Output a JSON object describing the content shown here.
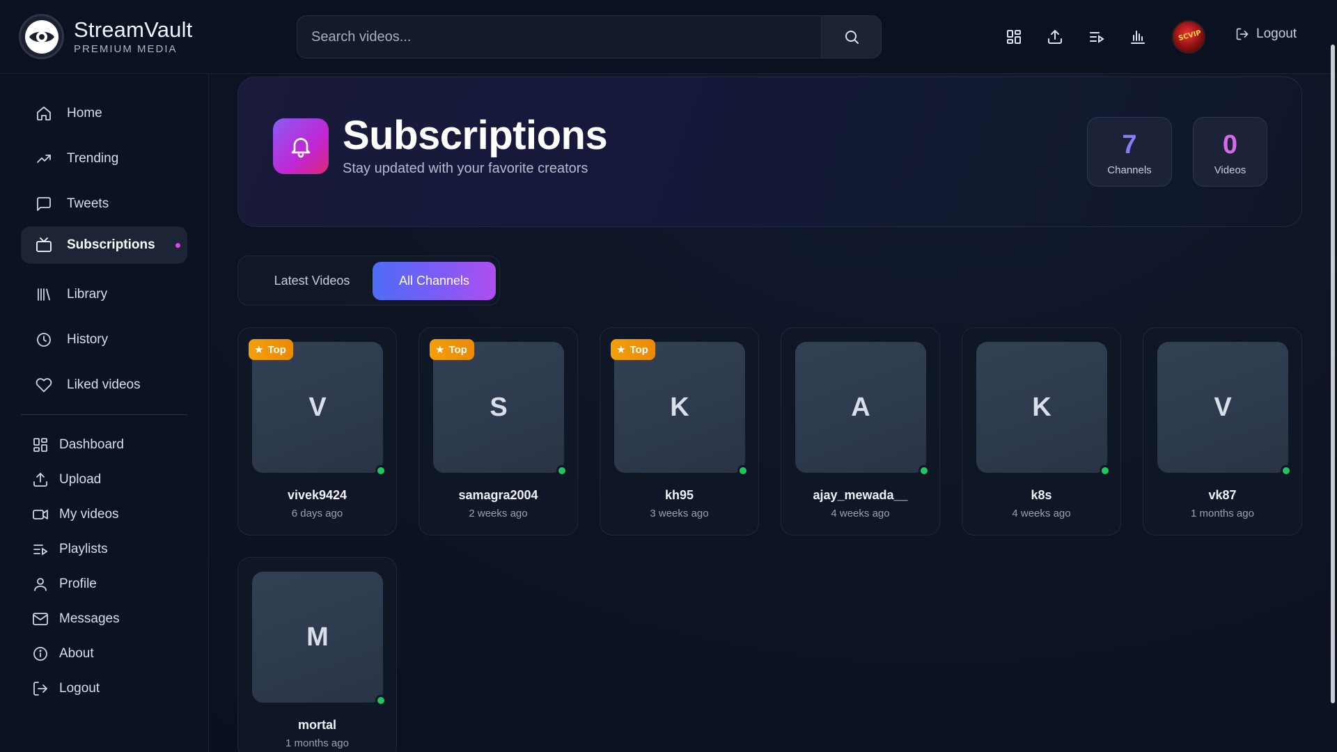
{
  "app": {
    "name": "StreamVault",
    "tagline": "PREMIUM MEDIA"
  },
  "search": {
    "placeholder": "Search videos..."
  },
  "header": {
    "icons": [
      "dashboard-icon",
      "upload-icon",
      "playlist-icon",
      "stats-icon"
    ],
    "logout_label": "Logout"
  },
  "sidebar": {
    "primary": [
      {
        "label": "Home",
        "icon": "home-icon"
      },
      {
        "label": "Trending",
        "icon": "trending-icon"
      },
      {
        "label": "Tweets",
        "icon": "message-square-icon"
      },
      {
        "label": "Subscriptions",
        "icon": "tv-icon",
        "active": true
      },
      {
        "label": "Library",
        "icon": "library-icon"
      },
      {
        "label": "History",
        "icon": "clock-icon"
      },
      {
        "label": "Liked videos",
        "icon": "heart-icon"
      }
    ],
    "secondary": [
      {
        "label": "Dashboard",
        "icon": "dashboard-icon"
      },
      {
        "label": "Upload",
        "icon": "upload-icon"
      },
      {
        "label": "My videos",
        "icon": "video-icon"
      },
      {
        "label": "Playlists",
        "icon": "playlist-icon"
      },
      {
        "label": "Profile",
        "icon": "user-icon"
      },
      {
        "label": "Messages",
        "icon": "mail-icon"
      },
      {
        "label": "About",
        "icon": "info-icon"
      },
      {
        "label": "Logout",
        "icon": "logout-icon"
      }
    ]
  },
  "hero": {
    "title": "Subscriptions",
    "subtitle": "Stay updated with your favorite creators",
    "stats": [
      {
        "value": "7",
        "label": "Channels",
        "color": "#8b7cf6"
      },
      {
        "value": "0",
        "label": "Videos",
        "color": "#d46be8"
      }
    ]
  },
  "tabs": [
    {
      "label": "Latest Videos",
      "active": false
    },
    {
      "label": "All Channels",
      "active": true
    }
  ],
  "channels": [
    {
      "initial": "V",
      "name": "vivek9424",
      "time": "6 days ago",
      "top": true,
      "badge": "Top",
      "online": true
    },
    {
      "initial": "S",
      "name": "samagra2004",
      "time": "2 weeks ago",
      "top": true,
      "badge": "Top",
      "online": true
    },
    {
      "initial": "K",
      "name": "kh95",
      "time": "3 weeks ago",
      "top": true,
      "badge": "Top",
      "online": true
    },
    {
      "initial": "A",
      "name": "ajay_mewada__",
      "time": "4 weeks ago",
      "top": false,
      "online": true
    },
    {
      "initial": "K",
      "name": "k8s",
      "time": "4 weeks ago",
      "top": false,
      "online": true
    },
    {
      "initial": "V",
      "name": "vk87",
      "time": "1 months ago",
      "top": false,
      "online": true
    },
    {
      "initial": "M",
      "name": "mortal",
      "time": "1 months ago",
      "top": false,
      "online": true
    }
  ],
  "colors": {
    "accent_start": "#4f6cf7",
    "accent_end": "#b04ef0",
    "online": "#22c55e",
    "top_badge": "#f59e0b"
  }
}
